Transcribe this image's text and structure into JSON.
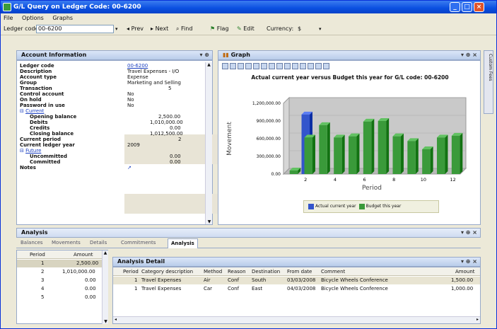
{
  "window": {
    "title": "G/L Query on Ledger Code: 00-6200"
  },
  "menu": [
    "File",
    "Options",
    "Graphs"
  ],
  "toolbar": {
    "ledger_label": "Ledger code:",
    "ledger_value": "00-6200",
    "prev": "Prev",
    "next": "Next",
    "find": "Find",
    "flag": "Flag",
    "edit": "Edit",
    "currency_label": "Currency:",
    "currency_value": "$"
  },
  "account": {
    "panel_title": "Account Information",
    "fields": [
      {
        "label": "Ledger code",
        "value": "00-6200"
      },
      {
        "label": "Description",
        "value": "Travel Expenses - I/O"
      },
      {
        "label": "Account type",
        "value": "Expense"
      },
      {
        "label": "Group",
        "value": "Marketing and Selling"
      },
      {
        "label": "Transaction",
        "value": "5"
      },
      {
        "label": "Control account",
        "value": "No"
      },
      {
        "label": "On hold",
        "value": "No"
      },
      {
        "label": "Password in use",
        "value": "No"
      }
    ],
    "current_label": "Current",
    "current": [
      {
        "label": "Opening balance",
        "value": "2,500.00"
      },
      {
        "label": "Debits",
        "value": "1,010,000.00"
      },
      {
        "label": "Credits",
        "value": "0.00"
      },
      {
        "label": "Closing balance",
        "value": "1,012,500.00"
      }
    ],
    "current_period_label": "Current period",
    "current_period_value": "2",
    "current_year_label": "Current ledger year",
    "current_year_value": "2009",
    "future_label": "Future",
    "future": [
      {
        "label": "Uncommitted",
        "value": "0.00"
      },
      {
        "label": "Committed",
        "value": "0.00"
      }
    ],
    "notes_label": "Notes"
  },
  "graph": {
    "panel_title": "Graph",
    "side_tab": "Custom Fees"
  },
  "chart_data": {
    "type": "bar",
    "title": "Actual current year versus Budget this year for G/L code: 00-6200",
    "xlabel": "Period",
    "ylabel": "Movement",
    "x_ticks": [
      "2",
      "4",
      "6",
      "8",
      "10",
      "12"
    ],
    "y_ticks": [
      "0.00",
      "300,000.00",
      "600,000.00",
      "900,000.00",
      "1,200,000.00"
    ],
    "ylim": [
      0,
      1200000
    ],
    "categories": [
      "1",
      "2",
      "3",
      "4",
      "5",
      "6",
      "7",
      "8",
      "9",
      "10",
      "11",
      "12"
    ],
    "series": [
      {
        "name": "Actual current year",
        "color": "#3355cc",
        "values": [
          0,
          1010000,
          0,
          0,
          0,
          0,
          0,
          0,
          0,
          0,
          0,
          0
        ]
      },
      {
        "name": "Budget this year",
        "color": "#3a9a3a",
        "values": [
          60000,
          620000,
          830000,
          620000,
          640000,
          890000,
          900000,
          640000,
          560000,
          420000,
          620000,
          650000
        ]
      }
    ],
    "legend_position": "bottom-right"
  },
  "analysis": {
    "panel_title": "Analysis",
    "tabs": [
      "Balances",
      "Movements",
      "Details",
      "Commitments",
      "Analysis"
    ],
    "active_tab": "Analysis",
    "period_table": {
      "headers": [
        "Period",
        "Amount"
      ],
      "rows": [
        [
          "1",
          "2,500.00"
        ],
        [
          "2",
          "1,010,000.00"
        ],
        [
          "3",
          "0.00"
        ],
        [
          "4",
          "0.00"
        ],
        [
          "5",
          "0.00"
        ]
      ]
    },
    "detail": {
      "title": "Analysis Detail",
      "headers": [
        "Period",
        "Category description",
        "Method",
        "Reason",
        "Destination",
        "From date",
        "Comment",
        "Amount"
      ],
      "rows": [
        [
          "1",
          "Travel Expenses",
          "Air",
          "Conf",
          "South",
          "03/03/2008",
          "Bicycle Wheels Conference",
          "1,500.00"
        ],
        [
          "1",
          "Travel Expenses",
          "Car",
          "Conf",
          "East",
          "04/03/2008",
          "Bicycle Wheels Conference",
          "1,000.00"
        ]
      ]
    }
  }
}
